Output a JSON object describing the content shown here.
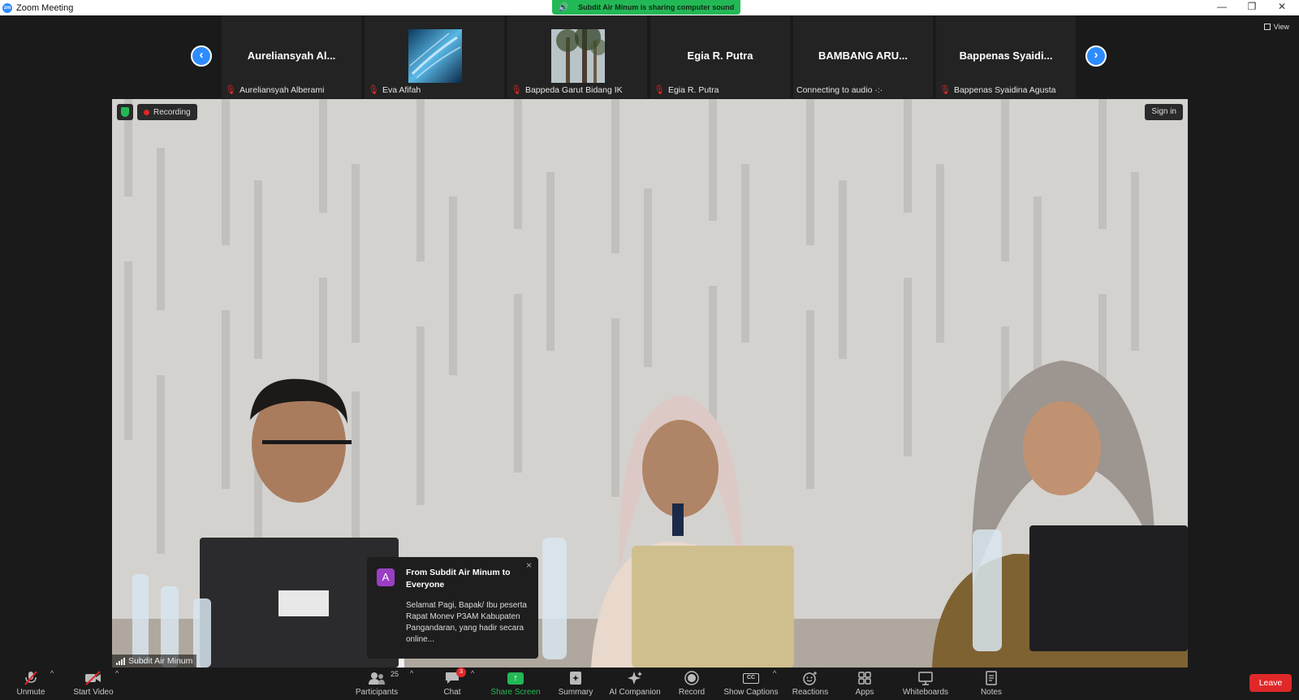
{
  "window": {
    "title": "Zoom Meeting",
    "minimize": "—",
    "restore": "❐",
    "close": "✕"
  },
  "share_banner": {
    "text": "Subdit Air Minum is sharing computer sound"
  },
  "gallery": {
    "view_label": "View",
    "prev_arrow": "‹",
    "next_arrow": "›",
    "tiles": [
      {
        "big_name": "Aureliansyah  Al...",
        "label": "Aureliansyah Alberami",
        "muted": true
      },
      {
        "big_name": "",
        "label": "Eva Afifah",
        "muted": true
      },
      {
        "big_name": "",
        "label": "Bappeda Garut Bidang IK",
        "muted": true
      },
      {
        "big_name": "Egia R. Putra",
        "label": "Egia R. Putra",
        "muted": true
      },
      {
        "big_name": "BAMBANG ARU...",
        "label": "Connecting to audio ·:·",
        "muted": false
      },
      {
        "big_name": "Bappenas  Syaidi...",
        "label": "Bappenas Syaidina Agusta",
        "muted": true
      }
    ]
  },
  "video": {
    "recording_label": "Recording",
    "signin_label": "Sign in",
    "speaker_name": "Subdit Air Minum"
  },
  "chat_popup": {
    "avatar_letter": "A",
    "from": "From Subdit Air Minum to Everyone",
    "message": "Selamat Pagi, Bapak/ Ibu peserta Rapat Monev P3AM Kabupaten Pangandaran, yang hadir secara online...",
    "close": "×"
  },
  "toolbar": {
    "unmute": "Unmute",
    "start_video": "Start Video",
    "participants": "Participants",
    "participants_count": "25",
    "chat": "Chat",
    "chat_badge": "3",
    "share_screen": "Share Screen",
    "summary": "Summary",
    "ai_companion": "AI Companion",
    "record": "Record",
    "show_captions": "Show Captions",
    "reactions": "Reactions",
    "apps": "Apps",
    "whiteboards": "Whiteboards",
    "notes": "Notes",
    "leave": "Leave",
    "caret": "^",
    "cc": "CC"
  },
  "colors": {
    "accent": "#2d8cff",
    "share_green": "#23b856",
    "leave_red": "#e02828",
    "background": "#1a1a1a"
  }
}
